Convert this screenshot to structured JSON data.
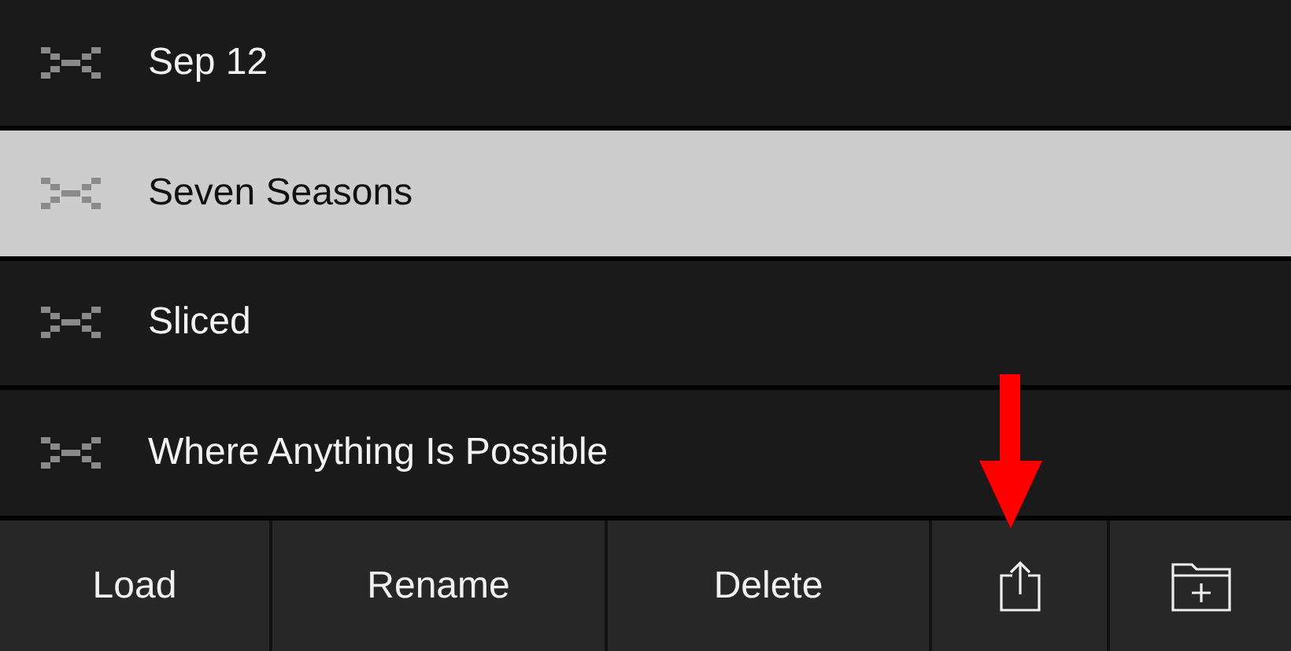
{
  "presets": [
    {
      "name": "Sep 12",
      "selected": false
    },
    {
      "name": "Seven Seasons",
      "selected": true
    },
    {
      "name": "Sliced",
      "selected": false
    },
    {
      "name": "Where Anything Is Possible",
      "selected": false
    }
  ],
  "toolbar": [
    {
      "kind": "text",
      "label": "Load"
    },
    {
      "kind": "text",
      "label": "Rename"
    },
    {
      "kind": "text",
      "label": "Delete"
    },
    {
      "kind": "share"
    },
    {
      "kind": "new-folder"
    }
  ]
}
